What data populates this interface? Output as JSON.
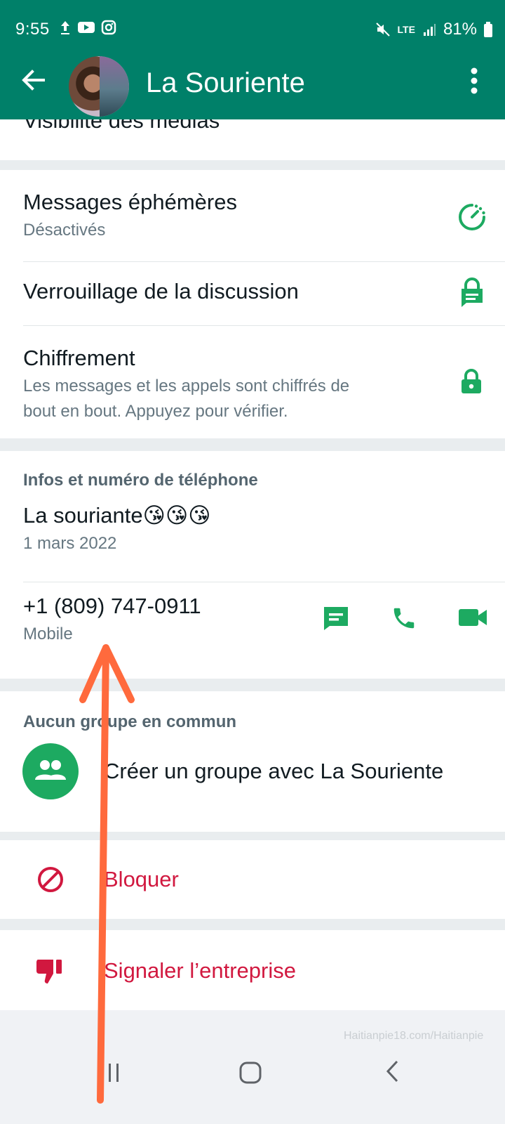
{
  "status_bar": {
    "time": "9:55",
    "battery": "81%",
    "network": "LTE"
  },
  "header": {
    "title": "La Souriente"
  },
  "media": {
    "label": "Visibilité des médias"
  },
  "ephemeral": {
    "title": "Messages éphémères",
    "subtitle": "Désactivés"
  },
  "lock_chat": {
    "title": "Verrouillage de la discussion"
  },
  "encryption": {
    "title": "Chiffrement",
    "subtitle_line1": "Les messages et les appels sont chiffrés de",
    "subtitle_line2": "bout en bout. Appuyez pour vérifier."
  },
  "info": {
    "section_label": "Infos et numéro de téléphone",
    "about": "La souriante😘😘😘",
    "about_date": "1 mars 2022",
    "phone": "+1 (809) 747-0911",
    "phone_type": "Mobile"
  },
  "groups": {
    "section_label": "Aucun groupe en commun",
    "create_label": "Créer un groupe avec La Souriente"
  },
  "actions": {
    "block": "Bloquer",
    "report": "Signaler l’entreprise"
  },
  "watermark": "Haitianpie18.com/Haitianpie",
  "colors": {
    "header": "#008069",
    "accent": "#1daa61",
    "danger": "#d1183f",
    "arrow": "#ff6a3d"
  }
}
